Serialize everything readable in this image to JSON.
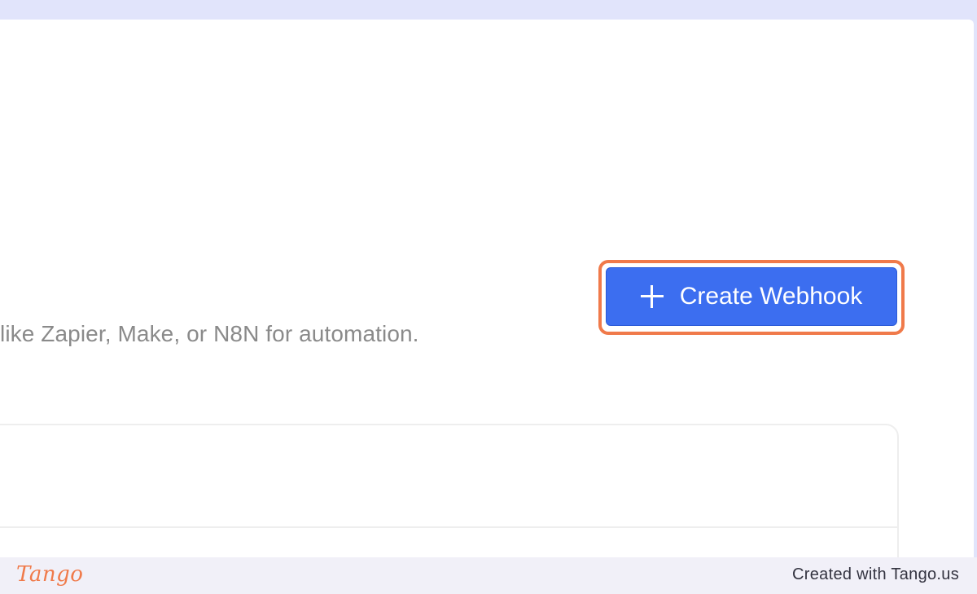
{
  "page": {
    "description": "like Zapier, Make, or N8N for automation.",
    "create_button": {
      "label": "Create Webhook",
      "icon": "plus-icon"
    }
  },
  "footer": {
    "logo_text": "Tango",
    "credit": "Created with Tango.us"
  },
  "colors": {
    "primary_button": "#3c6ef0",
    "highlight_outline": "#f07a4a",
    "frame_background": "#e1e4fb",
    "footer_background": "#f1f0f8"
  }
}
